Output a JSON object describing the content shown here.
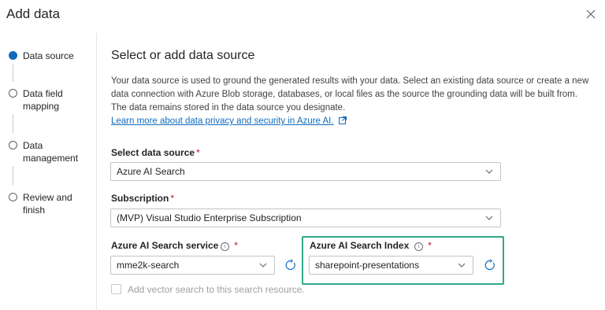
{
  "dialog": {
    "title": "Add data"
  },
  "steps": [
    {
      "label": "Data source",
      "state": "active"
    },
    {
      "label": "Data field mapping",
      "state": "inactive"
    },
    {
      "label": "Data management",
      "state": "inactive"
    },
    {
      "label": "Review and finish",
      "state": "inactive"
    }
  ],
  "main": {
    "heading": "Select or add data source",
    "description": "Your data source is used to ground the generated results with your data. Select an existing data source or create a new data connection with Azure Blob storage, databases, or local files as the source the grounding data will be built from. The data remains stored in the data source you designate.",
    "learn_more_link": "Learn more about data privacy and security in Azure AI."
  },
  "fields": {
    "data_source": {
      "label": "Select data source",
      "required": "*",
      "value": "Azure AI Search"
    },
    "subscription": {
      "label": "Subscription",
      "required": "*",
      "value": "(MVP) Visual Studio Enterprise Subscription"
    },
    "search_service": {
      "label": "Azure AI Search service",
      "required": "*",
      "value": "mme2k-search"
    },
    "search_index": {
      "label": "Azure AI Search Index",
      "required": "*",
      "value": "sharepoint-presentations"
    }
  },
  "vector_search": {
    "label": "Add vector search to this search resource.",
    "checked": false
  },
  "colors": {
    "accent": "#0f6cbd",
    "highlight": "#2fa98a",
    "required": "#c50f1f"
  }
}
